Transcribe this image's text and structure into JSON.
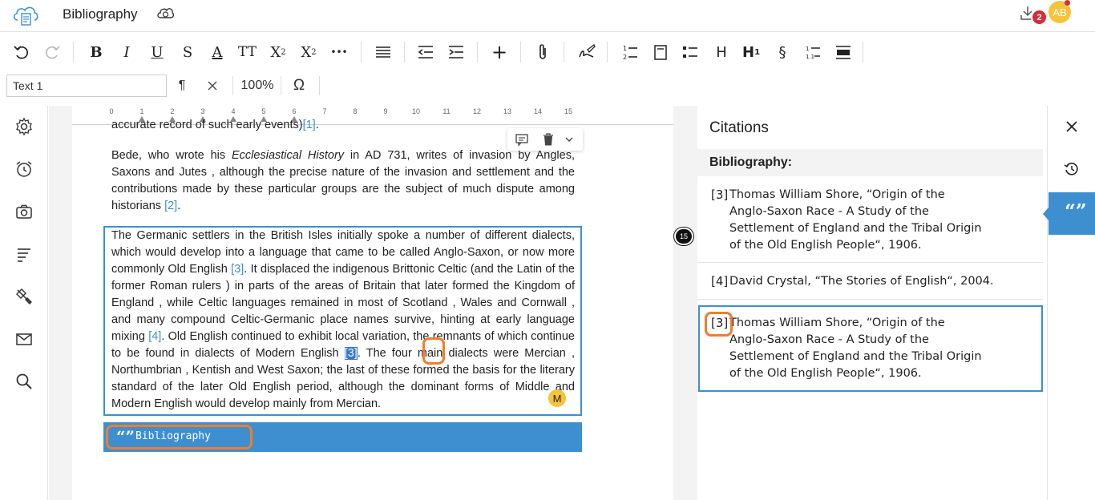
{
  "header": {
    "title": "Bibliography",
    "notification_count": "2",
    "avatar_initials": "AB"
  },
  "toolbar": {
    "bold": "B",
    "italic": "I",
    "underline": "U",
    "strike": "S",
    "text_color": "A",
    "font_size": "TT",
    "superscript": "X",
    "superscript_mark": "2",
    "subscript": "X",
    "subscript_mark": "2",
    "more": "•••",
    "add": "+",
    "heading": "H",
    "heading_num": "H",
    "heading_num_mark": "1",
    "section": "§"
  },
  "style_row": {
    "style_value": "Text 1",
    "pilcrow": "¶",
    "zoom": "100%",
    "omega": "Ω"
  },
  "ruler": {
    "numbers": [
      "0",
      "1",
      "2",
      "3",
      "4",
      "5",
      "6",
      "7",
      "8",
      "9",
      "10",
      "11",
      "12",
      "13",
      "14",
      "15"
    ]
  },
  "document": {
    "partial_line": "accurate record of such early events)",
    "partial_cite": "[1]",
    "partial_end": ".",
    "bede_1": "Bede, who wrote his ",
    "bede_italic": "Ecclesiastical History",
    "bede_2": " in AD 731, writes of invasion by Angles, Saxons and Jutes , although the precise nature of the invasion and settlement and the contributions made by these particular groups are the subject of much dispute among historians ",
    "bede_cite": "[2]",
    "bede_end": ".",
    "germ_1": "The Germanic settlers in the British Isles initially spoke a number of different dialects, which would develop into a language that came to be called Anglo-Saxon, or now more commonly  Old English ",
    "germ_cite1": "[3]",
    "germ_2": ". It displaced the indigenous  Brittonic  Celtic (and the  Latin  of the  former Roman rulers ) in parts of the areas of  Britain  that later formed the  Kingdom of England , while Celtic languages remained in most of  Scotland ,  Wales  and Cornwall , and many compound Celtic-Germanic place names survive, hinting at early language mixing ",
    "germ_cite2": "[4]",
    "germ_3": ". Old English continued to exhibit local variation, the remnants of which continue to be found in dialects of Modern English ",
    "germ_cite3": "[3]",
    "germ_4": ". The four main dialects were Mercian ,  Northumbrian ,  Kentish  and  West Saxon; the last of these formed the basis for the literary standard of the later Old English period, although the dominant forms of Middle and Modern English would develop mainly from Mercian.",
    "m_badge": "M",
    "bibliography_label": "Bibliography",
    "overflow_count": "15"
  },
  "citations": {
    "title": "Citations",
    "subheading": "Bibliography:",
    "items": [
      {
        "num": "[3]",
        "text": "Thomas William Shore, “Origin of the Anglo-Saxon Race - A Study of the Settlement of England and the Tribal Origin of the Old English People“, 1906."
      },
      {
        "num": "[4]",
        "text": "David Crystal, “The Stories of English“, 2004."
      },
      {
        "num": "[3]",
        "text": "Thomas William Shore, “Origin of the Anglo-Saxon Race - A Study of the Settlement of England and the Tribal Origin of the Old English People“, 1906."
      }
    ]
  },
  "colors": {
    "accent": "#3d8fd0",
    "highlight": "#ef7d2d",
    "badge": "#d62c3b",
    "avatar": "#f6c33a"
  },
  "icons": {
    "logo": "cloud-document-icon",
    "sync": "cloud-sync-icon",
    "download": "download-icon"
  }
}
